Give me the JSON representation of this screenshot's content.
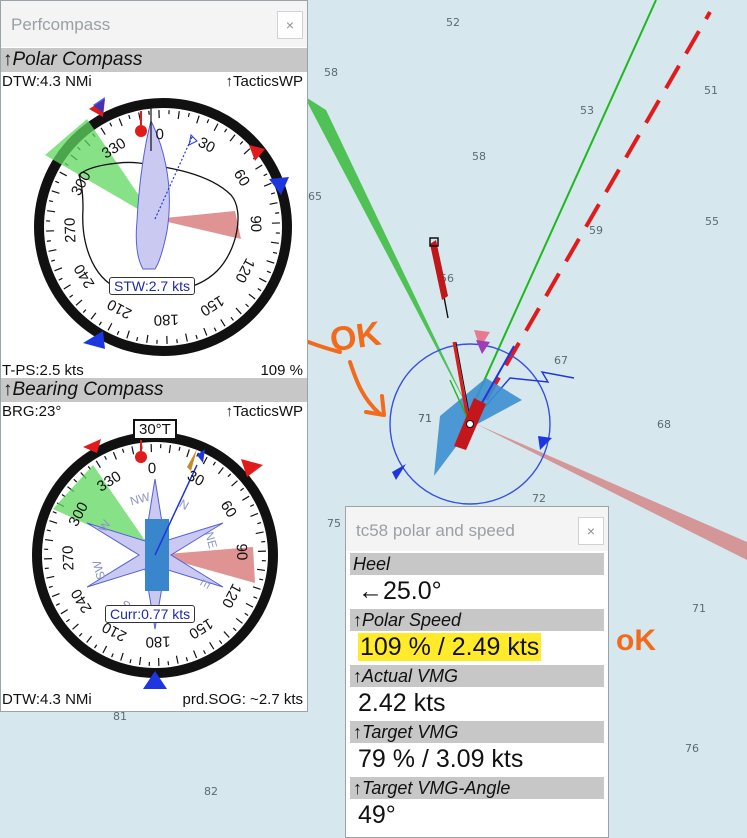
{
  "chart": {
    "depths": [
      "52",
      "58",
      "53",
      "51",
      "58",
      "55",
      "65",
      "59",
      "56",
      "67",
      "71",
      "68",
      "72",
      "75",
      "71",
      "76",
      "81",
      "82"
    ],
    "vessel_label": "71"
  },
  "perfcompass": {
    "title": "Perfcompass",
    "close": "×",
    "polar": {
      "header": "↑Polar Compass",
      "dtw": "DTW:4.3 NMi",
      "mode": "↑TacticsWP",
      "stw": "STW:2.7 kts",
      "tps": "T-PS:2.5 kts",
      "percent": "109 %",
      "labels": [
        "30",
        "60",
        "90",
        "120",
        "150",
        "180",
        "210",
        "240",
        "270",
        "300",
        "330",
        "0"
      ]
    },
    "bearing": {
      "header": "↑Bearing Compass",
      "brg": "BRG:23°",
      "mode": "↑TacticsWP",
      "heading": "30°T",
      "current": "Curr:0.77 kts",
      "dtw": "DTW:4.3 NMi",
      "sog": "prd.SOG: ~2.7 kts",
      "labels": [
        "30",
        "60",
        "90",
        "120",
        "150",
        "180",
        "210",
        "240",
        "270",
        "300",
        "330",
        "0"
      ],
      "rose": [
        "N",
        "NE",
        "E",
        "SE",
        "S",
        "SW",
        "W",
        "NW"
      ]
    }
  },
  "polarpanel": {
    "title": "tc58 polar and speed",
    "close": "×",
    "heel_label": "Heel",
    "heel_value": "←25.0°",
    "polar_speed_label": "↑Polar Speed",
    "polar_speed_value": "109 % / 2.49 kts",
    "actual_vmg_label": "↑Actual VMG",
    "actual_vmg_value": "2.42 kts",
    "target_vmg_label": "↑Target VMG",
    "target_vmg_value": "79 % / 3.09 kts",
    "target_angle_label": "↑Target VMG-Angle",
    "target_angle_value": "49°"
  },
  "annotations": {
    "ok1": "OK",
    "ok2": "oK"
  },
  "colors": {
    "water": "#d6e8ee",
    "red": "#e11b1b",
    "green": "#22b422",
    "blue": "#1e36e0",
    "orange": "#f26b1d",
    "highlight": "#ffeb2a"
  }
}
